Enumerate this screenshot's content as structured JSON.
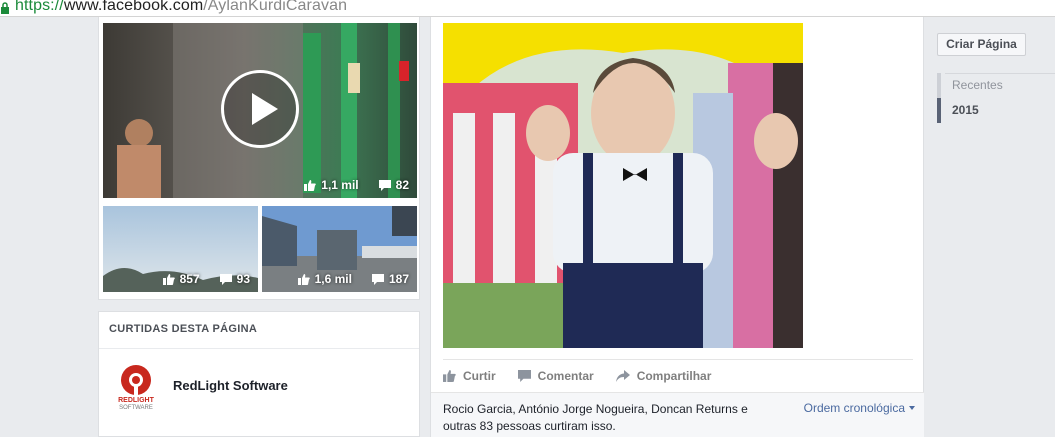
{
  "browser": {
    "url_scheme": "https://",
    "url_host": "www.facebook.com",
    "url_path": "/AylanKurdiCaravan"
  },
  "left": {
    "video": {
      "likes": "1,1 mil",
      "comments": "82"
    },
    "thumb1": {
      "likes": "857",
      "comments": "93"
    },
    "thumb2": {
      "likes": "1,6 mil",
      "comments": "187"
    },
    "liked_pages": {
      "header": "CURTIDAS DESTA PÁGINA",
      "items": [
        {
          "name": "RedLight Software",
          "logo_text_top": "REDLIGHT",
          "logo_text_bottom": "SOFTWARE"
        }
      ]
    }
  },
  "post": {
    "actions": {
      "like": "Curtir",
      "comment": "Comentar",
      "share": "Compartilhar"
    },
    "likes_summary": "Rocio Garcia, António Jorge Nogueira, Doncan Returns e outras 83 pessoas curtiram isso.",
    "order_label": "Ordem cronológica"
  },
  "right": {
    "create_page": "Criar Página",
    "timeline": [
      {
        "label": "Recentes",
        "active": false
      },
      {
        "label": "2015",
        "active": true
      }
    ]
  },
  "colors": {
    "accent_link": "#4b6aa0",
    "url_green": "#1b8a3a",
    "redlight_red": "#c8281e"
  }
}
